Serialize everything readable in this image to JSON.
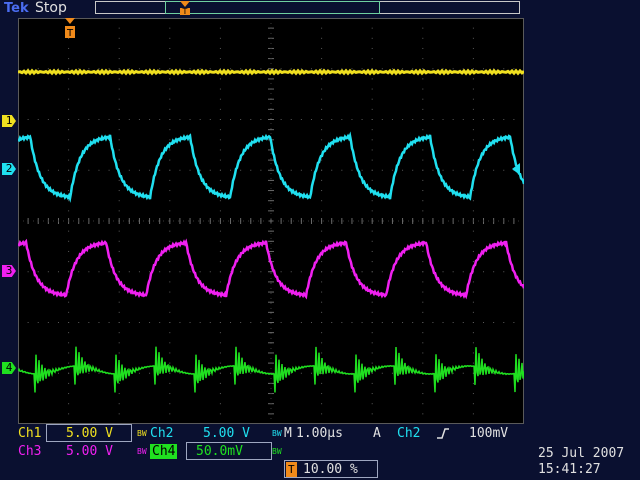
{
  "header": {
    "brand": "Tek",
    "status": "Stop"
  },
  "channels": [
    {
      "marker": "1",
      "color": "#f0e020"
    },
    {
      "marker": "2",
      "color": "#20e0f0"
    },
    {
      "marker": "3",
      "color": "#f020f0"
    },
    {
      "marker": "4",
      "color": "#20e020"
    }
  ],
  "trigger_marker": "T",
  "readout": {
    "ch1_label": "Ch1",
    "ch1_scale": "5.00 V",
    "ch1_bw": "BW",
    "ch2_label": "Ch2",
    "ch2_scale": "5.00 V",
    "ch2_bw": "BW",
    "ch3_label": "Ch3",
    "ch3_scale": "5.00 V",
    "ch3_bw": "BW",
    "ch4_label": "Ch4",
    "ch4_scale": "50.0mV",
    "ch4_bw": "BW",
    "timebase_label": "M",
    "timebase": "1.00µs",
    "acq_mode": "A",
    "trig_source": "Ch2",
    "trig_slope_icon": "rising-edge-icon",
    "trig_level": "100mV",
    "trig_position_icon": "T",
    "trig_position": "10.00 %",
    "date": "25 Jul   2007",
    "time": "15:41:27"
  }
}
